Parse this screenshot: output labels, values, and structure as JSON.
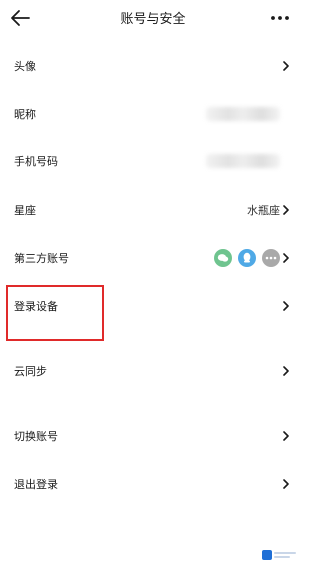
{
  "header": {
    "back_icon": "arrow-left-icon",
    "title": "账号与安全",
    "more_icon": "more-horizontal-icon"
  },
  "rows": {
    "avatar": {
      "label": "头像"
    },
    "nickname": {
      "label": "昵称"
    },
    "phone": {
      "label": "手机号码"
    },
    "constellation": {
      "label": "星座",
      "value": "水瓶座"
    },
    "third_party": {
      "label": "第三方账号",
      "icons": [
        "wechat-icon",
        "qq-icon",
        "more-accounts-icon"
      ],
      "colors": [
        "#6fc48f",
        "#4fa9e6",
        "#a9a9a9"
      ]
    },
    "login_devices": {
      "label": "登录设备"
    },
    "cloud_sync": {
      "label": "云同步"
    },
    "switch_account": {
      "label": "切换账号"
    },
    "logout": {
      "label": "退出登录"
    }
  },
  "colors": {
    "highlight": "#e02a2a"
  }
}
